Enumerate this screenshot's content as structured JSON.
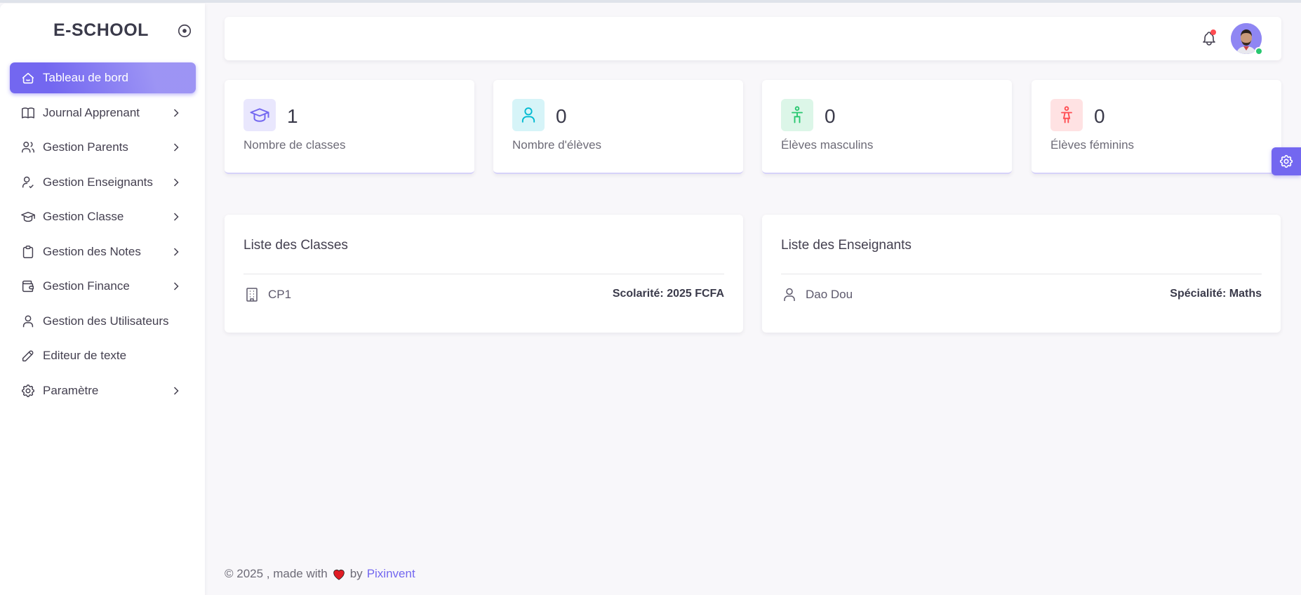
{
  "app": {
    "brand": "E-SCHOOL"
  },
  "sidebar": {
    "items": [
      {
        "label": "Tableau de bord",
        "icon": "smart-home-icon",
        "active": true,
        "has_submenu": false
      },
      {
        "label": "Journal Apprenant",
        "icon": "book-icon",
        "active": false,
        "has_submenu": true
      },
      {
        "label": "Gestion Parents",
        "icon": "users-icon",
        "active": false,
        "has_submenu": true
      },
      {
        "label": "Gestion Enseignants",
        "icon": "user-check-icon",
        "active": false,
        "has_submenu": true
      },
      {
        "label": "Gestion Classe",
        "icon": "graduation-cap-icon",
        "active": false,
        "has_submenu": true
      },
      {
        "label": "Gestion des Notes",
        "icon": "clipboard-icon",
        "active": false,
        "has_submenu": true
      },
      {
        "label": "Gestion Finance",
        "icon": "wallet-icon",
        "active": false,
        "has_submenu": true
      },
      {
        "label": "Gestion des Utilisateurs",
        "icon": "user-icon",
        "active": false,
        "has_submenu": false
      },
      {
        "label": "Editeur de texte",
        "icon": "pencil-icon",
        "active": false,
        "has_submenu": false
      },
      {
        "label": "Paramètre",
        "icon": "settings-icon",
        "active": false,
        "has_submenu": true
      }
    ]
  },
  "stats": [
    {
      "value": "1",
      "label": "Nombre de classes",
      "icon": "graduation-cap-icon",
      "color": "#7367f0",
      "bg": "#e9e7fd"
    },
    {
      "value": "0",
      "label": "Nombre d'élèves",
      "icon": "user-icon",
      "color": "#00bad1",
      "bg": "#d6f4f8"
    },
    {
      "value": "0",
      "label": "Élèves masculins",
      "icon": "man-icon",
      "color": "#28c76f",
      "bg": "#dcf6e8"
    },
    {
      "value": "0",
      "label": "Élèves féminins",
      "icon": "woman-icon",
      "color": "#ff4c51",
      "bg": "#ffe2e3"
    }
  ],
  "classes": {
    "title": "Liste des Classes",
    "rows": [
      {
        "name": "CP1",
        "meta": "Scolarité: 2025 FCFA"
      }
    ]
  },
  "teachers": {
    "title": "Liste des Enseignants",
    "rows": [
      {
        "name": "Dao Dou",
        "meta": "Spécialité: Maths"
      }
    ]
  },
  "footer": {
    "prefix": "© 2025 , made with",
    "by": "by",
    "link": "Pixinvent"
  },
  "colors": {
    "primary": "#7367f0",
    "success": "#28c76f",
    "danger": "#ff4c51",
    "info": "#00bad1"
  }
}
